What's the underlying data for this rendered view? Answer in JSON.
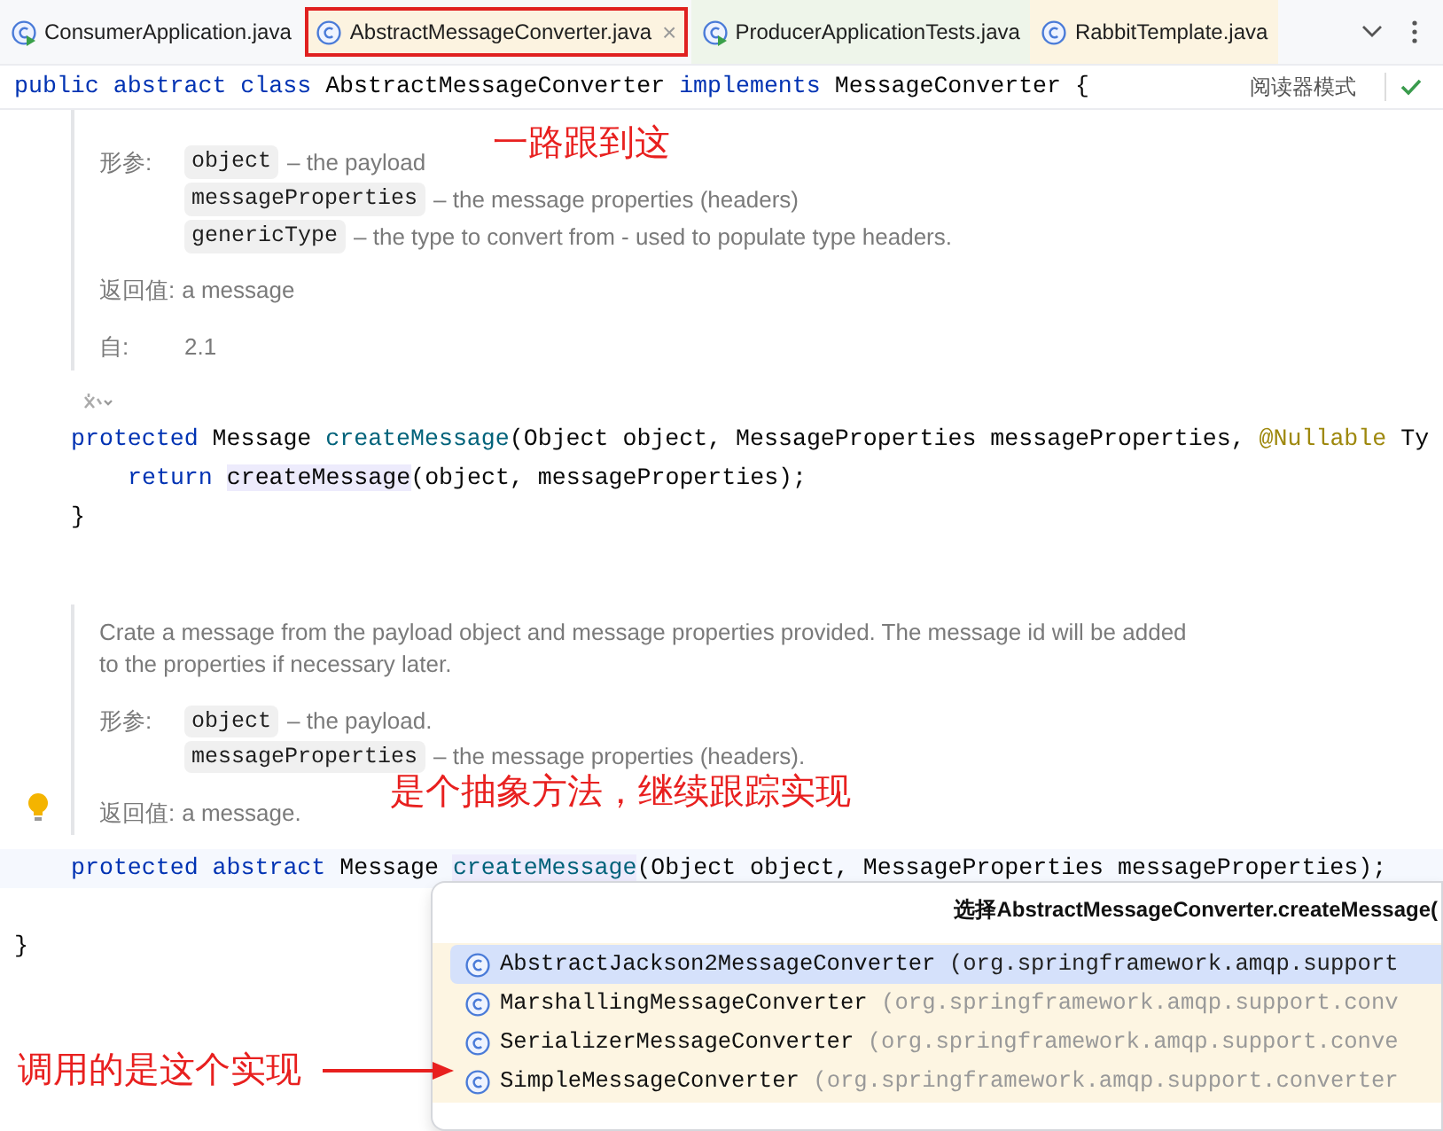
{
  "tabs": [
    {
      "label": "ConsumerApplication.java",
      "kind": "run-class",
      "color": "#f7f8fa",
      "selected": false
    },
    {
      "label": "AbstractMessageConverter.java",
      "kind": "class",
      "color": "#fcf3e0",
      "selected": true,
      "close": "×"
    },
    {
      "label": "ProducerApplicationTests.java",
      "kind": "run-class",
      "color": "#eef5ea",
      "selected": false
    },
    {
      "label": "RabbitTemplate.java",
      "kind": "class",
      "color": "#fcf4e1",
      "selected": false
    }
  ],
  "header_line": [
    {
      "text": "public abstract class ",
      "kind": "kw"
    },
    {
      "text": "AbstractMessageConverter ",
      "kind": "plain"
    },
    {
      "text": "implements ",
      "kind": "kw"
    },
    {
      "text": "MessageConverter {",
      "kind": "plain"
    }
  ],
  "reader_mode": "阅读器模式",
  "doc_1": {
    "params_label": "形参:",
    "params": [
      {
        "name": "object",
        "desc": "– the payload"
      },
      {
        "name": "messageProperties",
        "desc": "– the message properties (headers)"
      },
      {
        "name": "genericType",
        "desc": "– the type to convert from - used to populate type headers."
      }
    ],
    "returns_label": "返回值:",
    "returns": "a message",
    "since_label": "自:",
    "since": "2.1"
  },
  "code_1": [
    [
      {
        "text": "protected ",
        "kind": "kw"
      },
      {
        "text": "Message ",
        "kind": "plain"
      },
      {
        "text": "createMessage",
        "kind": "fn"
      },
      {
        "text": "(Object object, MessageProperties messageProperties, ",
        "kind": "plain"
      },
      {
        "text": "@Nullable",
        "kind": "ann"
      },
      {
        "text": " Ty",
        "kind": "plain"
      }
    ],
    [
      {
        "text": "return ",
        "kind": "kw"
      },
      {
        "text": "createMessage",
        "kind": "call-hl"
      },
      {
        "text": "(object, messageProperties);",
        "kind": "plain"
      }
    ],
    [
      {
        "text": "}",
        "kind": "plain"
      }
    ]
  ],
  "doc_2": {
    "text": "Crate a message from the payload object and message properties provided. The message id will be added to the properties if necessary later.",
    "params_label": "形参:",
    "params": [
      {
        "name": "object",
        "desc": "– the payload."
      },
      {
        "name": "messageProperties",
        "desc": "– the message properties (headers)."
      }
    ],
    "returns_label": "返回值:",
    "returns": "a message."
  },
  "code_2": [
    [
      {
        "text": "protected abstract ",
        "kind": "kw"
      },
      {
        "text": "Message ",
        "kind": "plain"
      },
      {
        "text": "createMessage",
        "kind": "fn-hl"
      },
      {
        "text": "(Object object, MessageProperties messageProperties);",
        "kind": "plain"
      }
    ],
    [
      {
        "text": "}",
        "kind": "plain"
      }
    ]
  ],
  "popup": {
    "title": "选择AbstractMessageConverter.createMessage(",
    "items": [
      {
        "name": "AbstractJackson2MessageConverter",
        "package": "(org.springframework.amqp.support",
        "selected": true
      },
      {
        "name": "MarshallingMessageConverter",
        "package": "(org.springframework.amqp.support.conv",
        "selected": false
      },
      {
        "name": "SerializerMessageConverter",
        "package": "(org.springframework.amqp.support.conve",
        "selected": false
      },
      {
        "name": "SimpleMessageConverter",
        "package": "(org.springframework.amqp.support.converter",
        "selected": false
      }
    ]
  },
  "annotations": [
    "一路跟到这",
    "是个抽象方法，继续跟踪实现",
    "调用的是这个实现"
  ]
}
